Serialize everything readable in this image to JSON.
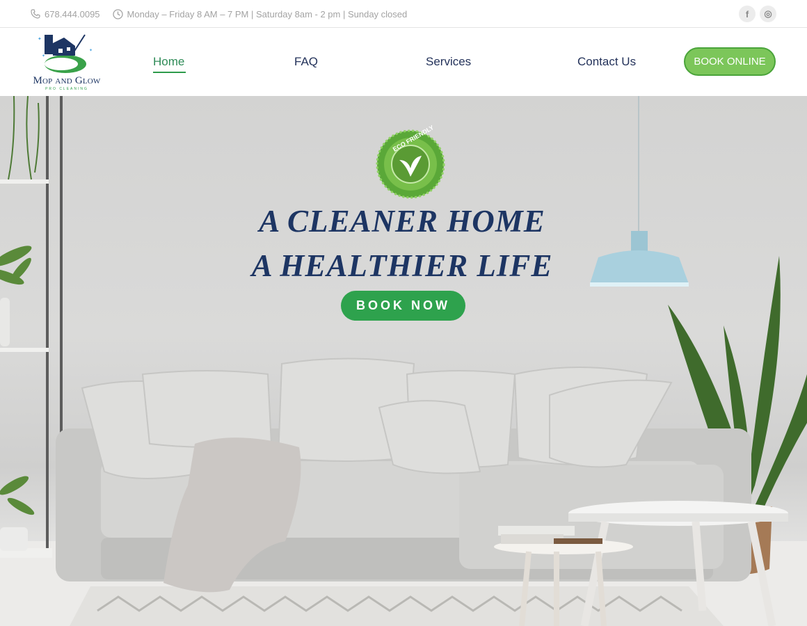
{
  "topbar": {
    "phone": "678.444.0095",
    "hours": "Monday – Friday 8 AM – 7 PM | Saturday 8am - 2 pm | Sunday closed",
    "icons": [
      "phone-icon",
      "clock-icon"
    ],
    "social": [
      "facebook-icon",
      "instagram-icon"
    ],
    "social_glyphs": [
      "f",
      "◎"
    ]
  },
  "logo": {
    "name": "Mop and Glow",
    "sub": "PRO CLEANING"
  },
  "nav": {
    "items": [
      {
        "label": "Home",
        "active": true
      },
      {
        "label": "FAQ"
      },
      {
        "label": "Services"
      },
      {
        "label": "Contact Us"
      }
    ],
    "cta": "BOOK ONLINE"
  },
  "hero": {
    "badge_text": "ECO FRIENDLY",
    "headline_1": "A CLEANER HOME",
    "headline_2": "A HEALTHIER LIFE",
    "cta": "BOOK NOW"
  },
  "colors": {
    "brand_navy": "#1d3563",
    "brand_green": "#2ea24d",
    "cta_light_green": "#7cc65a"
  }
}
